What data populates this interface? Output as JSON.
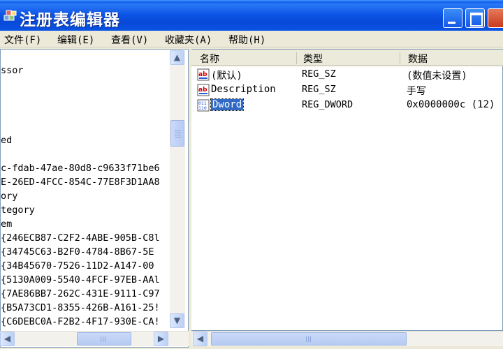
{
  "window": {
    "title": "注册表编辑器"
  },
  "menu": [
    "文件(F)",
    "编辑(E)",
    "查看(V)",
    "收藏夹(A)",
    "帮助(H)"
  ],
  "tree": [
    "ssor",
    "",
    "",
    "",
    "",
    "ed",
    "",
    "c-fdab-47ae-80d8-c9633f71be6",
    "E-26ED-4FCC-854C-77E8F3D1AA8",
    "ory",
    "tegory",
    "em",
    " {246ECB87-C2F2-4ABE-905B-C8l",
    " {34745C63-B2F0-4784-8B67-5E",
    " {34B45670-7526-11D2-A147-00",
    " {5130A009-5540-4FCF-97EB-AAl",
    " {7AE86BB7-262C-431E-9111-C97",
    " {B5A73CD1-8355-426B-A161-25!",
    " {C6DEBC0A-F2B2-4F17-930E-CA!"
  ],
  "list": {
    "columns": [
      "名称",
      "类型",
      "数据"
    ],
    "rows": [
      {
        "icon": "string-value-icon",
        "name": "(默认)",
        "type": "REG_SZ",
        "data": "(数值未设置)",
        "selected": false
      },
      {
        "icon": "string-value-icon",
        "name": "Description",
        "type": "REG_SZ",
        "data": "手写",
        "selected": false
      },
      {
        "icon": "dword-value-icon",
        "name": "Dword",
        "type": "REG_DWORD",
        "data": "0x0000000c (12)",
        "selected": true
      }
    ]
  },
  "scrollbars": {
    "up": "▲",
    "down": "▼",
    "left": "◀",
    "right": "▶"
  }
}
